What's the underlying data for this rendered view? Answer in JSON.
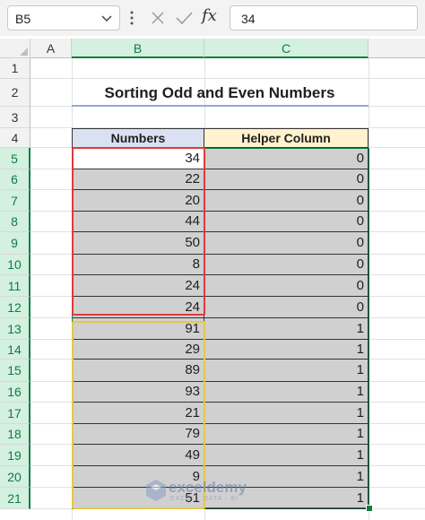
{
  "formula_bar": {
    "name_box": "B5",
    "formula": "34",
    "fx_label": "fx"
  },
  "columns": [
    "A",
    "B",
    "C"
  ],
  "rows": [
    "1",
    "2",
    "3",
    "4",
    "5",
    "6",
    "7",
    "8",
    "9",
    "10",
    "11",
    "12",
    "13",
    "14",
    "15",
    "16",
    "17",
    "18",
    "19",
    "20",
    "21"
  ],
  "sheet": {
    "title": "Sorting Odd and Even Numbers",
    "headers": {
      "numbers": "Numbers",
      "helper": "Helper Column"
    },
    "numbers": [
      "34",
      "22",
      "20",
      "44",
      "50",
      "8",
      "24",
      "24",
      "91",
      "29",
      "89",
      "93",
      "21",
      "79",
      "49",
      "9",
      "51"
    ],
    "helper": [
      "0",
      "0",
      "0",
      "0",
      "0",
      "0",
      "0",
      "0",
      "1",
      "1",
      "1",
      "1",
      "1",
      "1",
      "1",
      "1",
      "1"
    ]
  },
  "watermark": {
    "brand": "exceldemy",
    "tagline": "EXCEL · DATA · BI"
  },
  "colors": {
    "accent_green": "#107c41",
    "even_outline": "#e03a3a",
    "odd_outline": "#e6c84a",
    "header_blue": "#d9e1f2",
    "header_yellow": "#fff2cc"
  }
}
